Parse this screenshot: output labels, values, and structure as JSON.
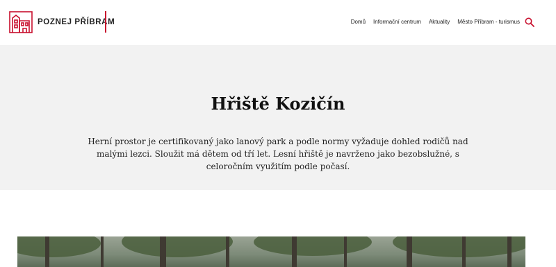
{
  "header": {
    "logo_text": "POZNEJ PŘÍBRAM",
    "brand_color": "#c8102e",
    "nav": [
      "Domů",
      "Informační centrum",
      "Aktuality",
      "Město Příbram - turismus"
    ],
    "search_icon": "search-icon"
  },
  "hero": {
    "title": "Hřiště Kozičín",
    "description": "Herní prostor je certifikovaný jako lanový park a podle normy vyžaduje dohled rodičů nad malými lezci. Sloužit má dětem od tří let. Lesní hřiště je navrženo jako bezobslužné, s celoročním využitím podle počasí."
  },
  "photo": {
    "subject": "forest-photo"
  }
}
